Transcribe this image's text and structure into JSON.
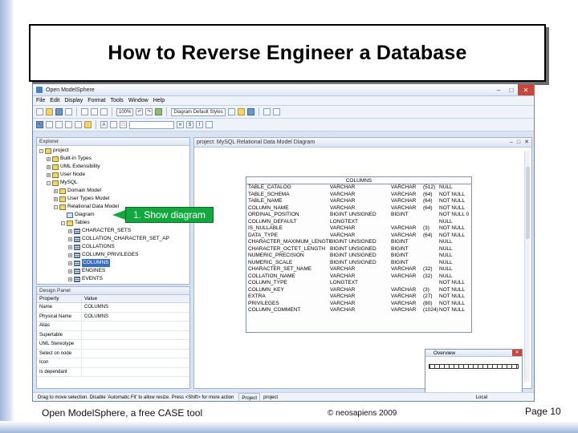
{
  "slide": {
    "title": "How to Reverse Engineer a Database",
    "footer_left": "Open ModelSphere, a free CASE tool",
    "footer_center": "© neosapiens 2009",
    "footer_right": "Page 10",
    "callout": "1. Show diagram"
  },
  "app": {
    "title": "Open ModelSphere",
    "menu": [
      "File",
      "Edit",
      "Display",
      "Format",
      "Tools",
      "Window",
      "Help"
    ],
    "toolbar": {
      "zoom": "100%",
      "style": "Diagram Default Styles"
    },
    "explorer": {
      "header": "Explorer",
      "tree": [
        {
          "label": "project",
          "depth": 0,
          "toggle": "-",
          "icon": "folder"
        },
        {
          "label": "Built-in Types",
          "depth": 1,
          "toggle": "+",
          "icon": "folder"
        },
        {
          "label": "UML Extensibility",
          "depth": 1,
          "toggle": "+",
          "icon": "folder"
        },
        {
          "label": "User Node",
          "depth": 1,
          "toggle": "+",
          "icon": "folder"
        },
        {
          "label": "MySQL",
          "depth": 1,
          "toggle": "-",
          "icon": "folder"
        },
        {
          "label": "Domain Model",
          "depth": 2,
          "toggle": "+",
          "icon": "folder"
        },
        {
          "label": "User Types Model",
          "depth": 2,
          "toggle": "+",
          "icon": "folder"
        },
        {
          "label": "Relational Data Model",
          "depth": 2,
          "toggle": "-",
          "icon": "folder"
        },
        {
          "label": "Diagram",
          "depth": 3,
          "toggle": "",
          "icon": "diagram"
        },
        {
          "label": "Tables",
          "depth": 3,
          "toggle": "-",
          "icon": "folder"
        },
        {
          "label": "CHARACTER_SETS",
          "depth": 4,
          "toggle": "+",
          "icon": "table"
        },
        {
          "label": "COLLATION_CHARACTER_SET_AP",
          "depth": 4,
          "toggle": "+",
          "icon": "table"
        },
        {
          "label": "COLLATIONS",
          "depth": 4,
          "toggle": "+",
          "icon": "table"
        },
        {
          "label": "COLUMN_PRIVILEGES",
          "depth": 4,
          "toggle": "+",
          "icon": "table"
        },
        {
          "label": "COLUMNS",
          "depth": 4,
          "toggle": "+",
          "icon": "table",
          "selected": true
        },
        {
          "label": "ENGINES",
          "depth": 4,
          "toggle": "+",
          "icon": "table"
        },
        {
          "label": "EVENTS",
          "depth": 4,
          "toggle": "+",
          "icon": "table"
        }
      ]
    },
    "design_panel": {
      "header": "Design Panel",
      "col_property": "Property",
      "col_value": "Value",
      "rows": [
        {
          "property": "Name",
          "value": "COLUMNS"
        },
        {
          "property": "Physical Name",
          "value": "COLUMNS"
        },
        {
          "property": "Alias",
          "value": ""
        },
        {
          "property": "Supertable",
          "value": ""
        },
        {
          "property": "UML Stereotype",
          "value": ""
        },
        {
          "property": "Select on node",
          "value": ""
        },
        {
          "property": "Icon",
          "value": ""
        },
        {
          "property": "Is dependant",
          "value": ""
        }
      ]
    },
    "diagram": {
      "header": "project: MySQL Relational Data Model Diagram",
      "entity": {
        "name": "COLUMNS",
        "columns": [
          {
            "name": "TABLE_CATALOG",
            "type": "VARCHAR",
            "type2": "VARCHAR",
            "len": "(512)",
            "null": "NULL"
          },
          {
            "name": "TABLE_SCHEMA",
            "type": "VARCHAR",
            "type2": "VARCHAR",
            "len": "(64)",
            "null": "NOT NULL"
          },
          {
            "name": "TABLE_NAME",
            "type": "VARCHAR",
            "type2": "VARCHAR",
            "len": "(64)",
            "null": "NOT NULL"
          },
          {
            "name": "COLUMN_NAME",
            "type": "VARCHAR",
            "type2": "VARCHAR",
            "len": "(64)",
            "null": "NOT NULL"
          },
          {
            "name": "ORDINAL_POSITION",
            "type": "BIGINT UNSIGNED",
            "type2": "BIGINT",
            "len": "",
            "null": "NOT NULL  0"
          },
          {
            "name": "COLUMN_DEFAULT",
            "type": "LONGTEXT",
            "type2": "",
            "len": "",
            "null": "NULL"
          },
          {
            "name": "IS_NULLABLE",
            "type": "VARCHAR",
            "type2": "VARCHAR",
            "len": "(3)",
            "null": "NOT NULL"
          },
          {
            "name": "DATA_TYPE",
            "type": "VARCHAR",
            "type2": "VARCHAR",
            "len": "(64)",
            "null": "NOT NULL"
          },
          {
            "name": "CHARACTER_MAXIMUM_LENGTH",
            "type": "BIGINT UNSIGNED",
            "type2": "BIGINT",
            "len": "",
            "null": "NULL"
          },
          {
            "name": "CHARACTER_OCTET_LENGTH",
            "type": "BIGINT UNSIGNED",
            "type2": "BIGINT",
            "len": "",
            "null": "NULL"
          },
          {
            "name": "NUMERIC_PRECISION",
            "type": "BIGINT UNSIGNED",
            "type2": "BIGINT",
            "len": "",
            "null": "NULL"
          },
          {
            "name": "NUMERIC_SCALE",
            "type": "BIGINT UNSIGNED",
            "type2": "BIGINT",
            "len": "",
            "null": "NULL"
          },
          {
            "name": "CHARACTER_SET_NAME",
            "type": "VARCHAR",
            "type2": "VARCHAR",
            "len": "(32)",
            "null": "NULL"
          },
          {
            "name": "COLLATION_NAME",
            "type": "VARCHAR",
            "type2": "VARCHAR",
            "len": "(32)",
            "null": "NULL"
          },
          {
            "name": "COLUMN_TYPE",
            "type": "LONGTEXT",
            "type2": "",
            "len": "",
            "null": "NOT NULL"
          },
          {
            "name": "COLUMN_KEY",
            "type": "VARCHAR",
            "type2": "VARCHAR",
            "len": "(3)",
            "null": "NOT NULL"
          },
          {
            "name": "EXTRA",
            "type": "VARCHAR",
            "type2": "VARCHAR",
            "len": "(27)",
            "null": "NOT NULL"
          },
          {
            "name": "PRIVILEGES",
            "type": "VARCHAR",
            "type2": "VARCHAR",
            "len": "(80)",
            "null": "NOT NULL"
          },
          {
            "name": "COLUMN_COMMENT",
            "type": "VARCHAR",
            "type2": "VARCHAR",
            "len": "(1024)",
            "null": "NOT NULL"
          }
        ]
      }
    },
    "overview": {
      "title": "Overview"
    },
    "status": {
      "left": "Drag to move selection. Disable 'Automatic Fit' to allow resize. Press <Shift> for more action",
      "tab": "Project",
      "mid": "project",
      "right": "Local"
    }
  },
  "colors": {
    "callout": "#11a83d",
    "selection": "#3b6ec0",
    "frame": "#9fb7d9"
  }
}
